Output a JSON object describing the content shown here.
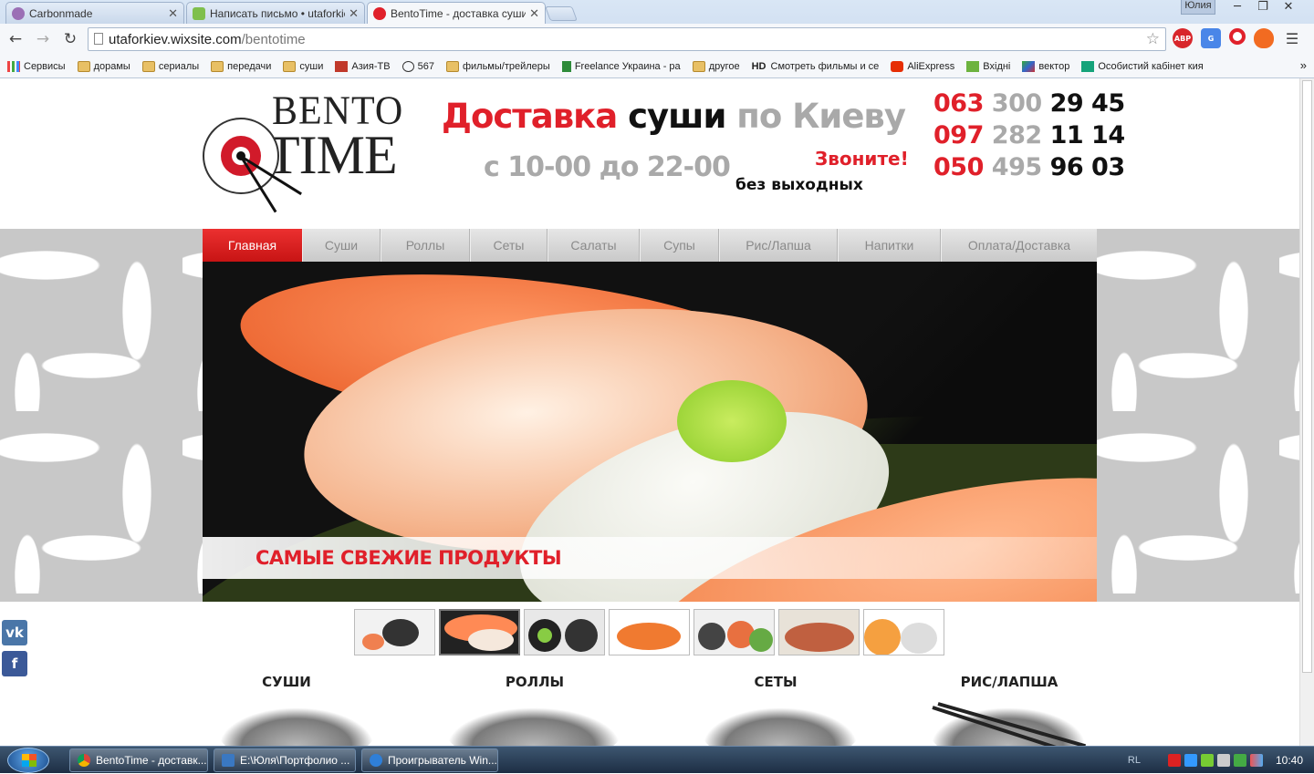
{
  "browser": {
    "tabs": [
      {
        "title": "Carbonmade",
        "favicon_color": "#9b6fb5"
      },
      {
        "title": "Написать письмо • utaforkiev",
        "favicon_color": "#7fbf4d"
      },
      {
        "title": "BentoTime - доставка суши",
        "favicon_color": "#e0202a"
      }
    ],
    "user": "Юлия",
    "url_host": "utaforkiev.wixsite.com",
    "url_path": "/bentotime",
    "extensions": [
      "adblock-icon",
      "translate-icon",
      "opera-icon",
      "fire-icon",
      "menu-icon"
    ],
    "extension_labels": {
      "adblock": "ABP"
    },
    "bookmarks": [
      {
        "label": "Сервисы",
        "icon": "apps-icon"
      },
      {
        "label": "дорамы",
        "icon": "folder-icon"
      },
      {
        "label": "сериалы",
        "icon": "folder-icon"
      },
      {
        "label": "передачи",
        "icon": "folder-icon"
      },
      {
        "label": "суши",
        "icon": "folder-icon"
      },
      {
        "label": "Азия-ТВ",
        "icon": "asiatv-icon"
      },
      {
        "label": "567",
        "icon": "b-icon"
      },
      {
        "label": "фильмы/трейлеры",
        "icon": "folder-icon"
      },
      {
        "label": "Freelance Украина - ра",
        "icon": "freelance-icon"
      },
      {
        "label": "другое",
        "icon": "folder-icon"
      },
      {
        "label": "Смотреть фильмы и се",
        "icon": "hd-icon",
        "prefix": "HD"
      },
      {
        "label": "AliExpress",
        "icon": "aliexpress-icon"
      },
      {
        "label": "Вхідні",
        "icon": "mail-icon"
      },
      {
        "label": "вектор",
        "icon": "vector-icon"
      },
      {
        "label": "Особистий кабінет кия",
        "icon": "k-icon"
      }
    ],
    "bookmarks_more": "»"
  },
  "site": {
    "logo": {
      "line1": "BENTO",
      "line2": "TIME"
    },
    "headline": {
      "part1": "Доставка",
      "part2": "суши",
      "part3": "по Киеву"
    },
    "hours": "с 10-00 до 22-00",
    "call_label": "Звоните!",
    "no_days_off": "без выходных",
    "phones": [
      {
        "code": "063",
        "mid": "300",
        "end": "29 45"
      },
      {
        "code": "097",
        "mid": "282",
        "end": "11 14"
      },
      {
        "code": "050",
        "mid": "495",
        "end": "96 03"
      }
    ],
    "menu": [
      {
        "label": "Главная",
        "active": true
      },
      {
        "label": "Суши",
        "active": false
      },
      {
        "label": "Роллы",
        "active": false
      },
      {
        "label": "Сеты",
        "active": false
      },
      {
        "label": "Салаты",
        "active": false
      },
      {
        "label": "Супы",
        "active": false
      },
      {
        "label": "Рис/Лапша",
        "active": false
      },
      {
        "label": "Напитки",
        "active": false
      },
      {
        "label": "Оплата/Доставка",
        "active": false
      }
    ],
    "hero_caption": "САМЫЕ СВЕЖИЕ ПРОДУКТЫ",
    "social": [
      {
        "label": "vk",
        "color": "#4a76a8"
      },
      {
        "label": "f",
        "color": "#3b5998"
      }
    ],
    "thumbnails_count": 7,
    "selected_thumbnail": 2,
    "categories": [
      "СУШИ",
      "РОЛЛЫ",
      "СЕТЫ",
      "РИС/ЛАПША"
    ],
    "colors": {
      "accent": "#e0202a",
      "menu_gray": "#8a8a8a",
      "phone_gray": "#a9a9a9"
    }
  },
  "taskbar": {
    "items": [
      {
        "title": "BentoTime - доставк...",
        "icon_color": "#e8b534"
      },
      {
        "title": "E:\\Юля\\Портфолио ...",
        "icon_color": "#3a78c2"
      },
      {
        "title": "Проигрыватель Win...",
        "icon_color": "#2f7fd8"
      }
    ],
    "lang": "RL",
    "clock": "10:40"
  }
}
